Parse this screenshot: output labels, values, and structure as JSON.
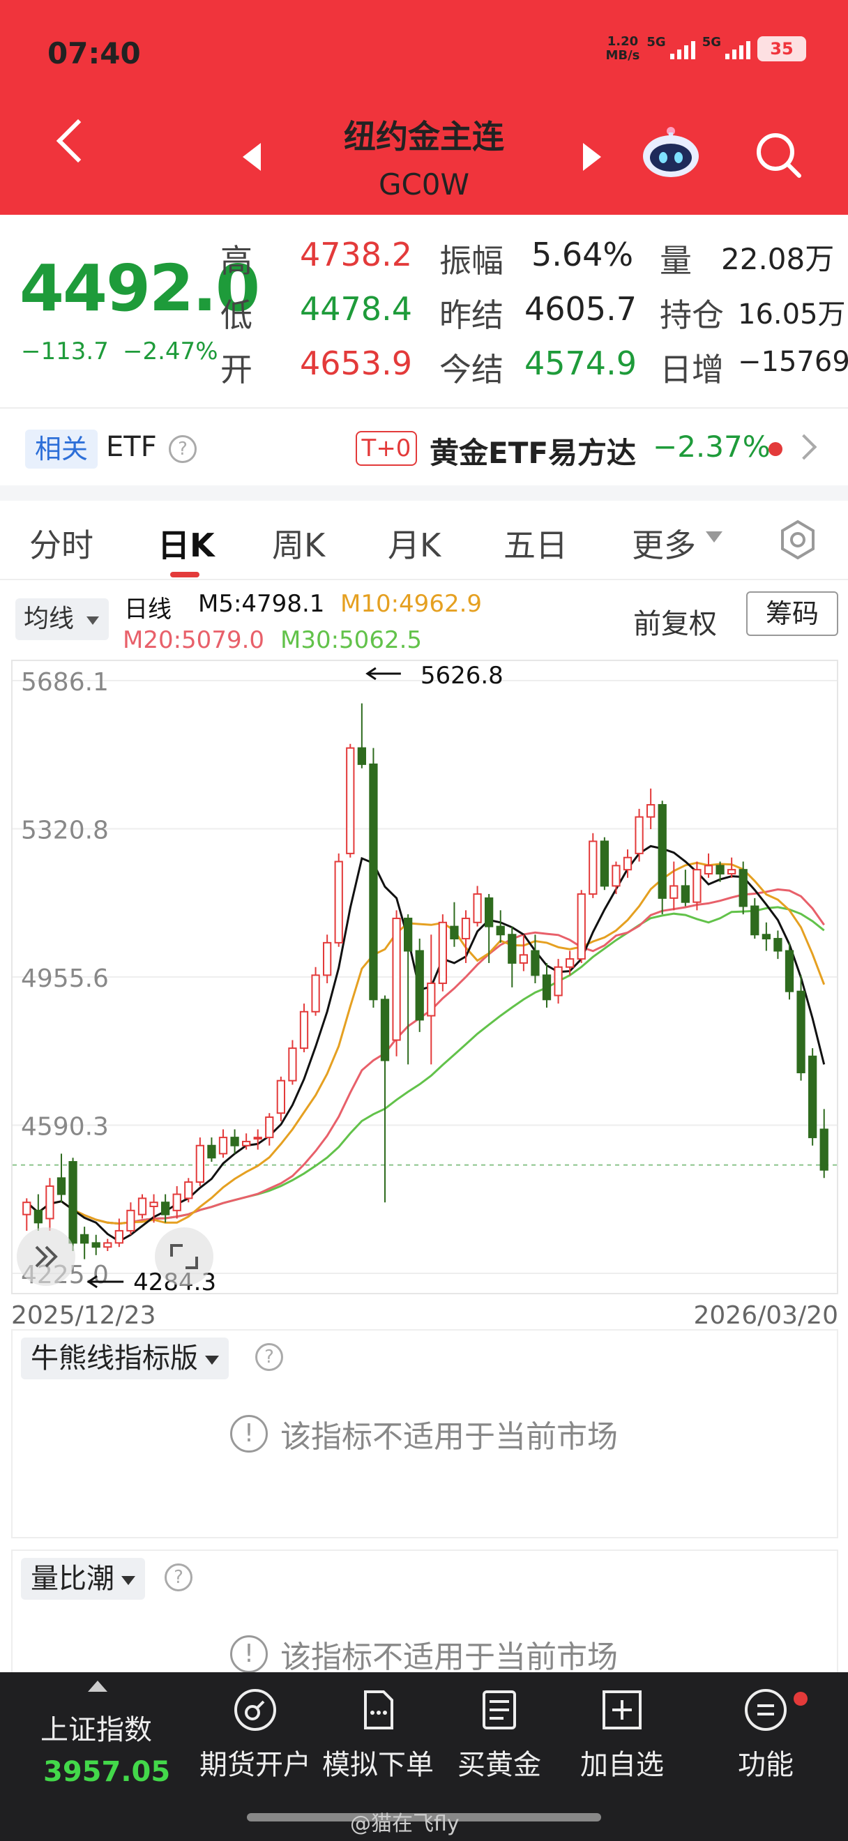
{
  "status_bar": {
    "time": "07:40",
    "net_speed_value": "1.20",
    "net_speed_unit": "MB/s",
    "signal1": "5G",
    "signal2": "5G",
    "battery": "35"
  },
  "header": {
    "title": "纽约金主连",
    "code": "GC0W",
    "bg_color": "#f0343c"
  },
  "quote": {
    "last": "4492.0",
    "change": "−113.7",
    "change_pct": "−2.47%",
    "high_label": "高",
    "high": "4738.2",
    "low_label": "低",
    "low": "4478.4",
    "open_label": "开",
    "open": "4653.9",
    "amp_label": "振幅",
    "amp": "5.64%",
    "prev_settle_label": "昨结",
    "prev_settle": "4605.7",
    "settle_label": "今结",
    "settle": "4574.9",
    "vol_label": "量",
    "vol": "22.08万",
    "oi_label": "持仓",
    "oi": "16.05万",
    "oi_chg_label": "日增",
    "oi_chg": "−15769"
  },
  "etf": {
    "tag": "相关",
    "word": "ETF",
    "t0": "T+0",
    "name": "黄金ETF易方达",
    "pct": "−2.37%"
  },
  "tabs": [
    {
      "label": "分时"
    },
    {
      "label": "日K"
    },
    {
      "label": "周K"
    },
    {
      "label": "月K"
    },
    {
      "label": "五日"
    },
    {
      "label": "更多"
    }
  ],
  "ma": {
    "select": "均线",
    "period": "日线",
    "m5": "M5:4798.1",
    "m10": "M10:4962.9",
    "m20": "M20:5079.0",
    "m30": "M30:5062.5",
    "adj": "前复权",
    "chips": "筹码",
    "colors": {
      "m5": "#111111",
      "m10": "#e5a021",
      "m20": "#e8606a",
      "m30": "#62c24a",
      "up": "#e33a3a",
      "down": "#2e6b1e"
    }
  },
  "chart_data": {
    "type": "candlestick",
    "y_ticks": [
      "5686.1",
      "5320.8",
      "4955.6",
      "4590.3",
      "4225.0"
    ],
    "ylim": [
      4225.0,
      5686.1
    ],
    "max_label": "5626.8",
    "min_label": "4284.3",
    "date_start": "2025/12/23",
    "date_end": "2026/03/20",
    "ref_line": 4492.0,
    "candles": [
      [
        4370,
        4400,
        4330,
        4410
      ],
      [
        4380,
        4350,
        4330,
        4420
      ],
      [
        4360,
        4440,
        4330,
        4460
      ],
      [
        4460,
        4420,
        4400,
        4520
      ],
      [
        4500,
        4300,
        4280,
        4510
      ],
      [
        4320,
        4300,
        4260,
        4340
      ],
      [
        4300,
        4290,
        4270,
        4320
      ],
      [
        4290,
        4300,
        4280,
        4310
      ],
      [
        4300,
        4330,
        4290,
        4360
      ],
      [
        4330,
        4380,
        4320,
        4400
      ],
      [
        4370,
        4410,
        4360,
        4420
      ],
      [
        4390,
        4400,
        4350,
        4420
      ],
      [
        4400,
        4370,
        4350,
        4420
      ],
      [
        4380,
        4420,
        4360,
        4440
      ],
      [
        4410,
        4450,
        4400,
        4460
      ],
      [
        4450,
        4540,
        4440,
        4560
      ],
      [
        4540,
        4510,
        4500,
        4560
      ],
      [
        4520,
        4560,
        4510,
        4580
      ],
      [
        4560,
        4540,
        4520,
        4580
      ],
      [
        4540,
        4550,
        4530,
        4570
      ],
      [
        4560,
        4560,
        4530,
        4580
      ],
      [
        4560,
        4610,
        4540,
        4620
      ],
      [
        4620,
        4700,
        4600,
        4710
      ],
      [
        4700,
        4780,
        4690,
        4800
      ],
      [
        4780,
        4870,
        4770,
        4890
      ],
      [
        4870,
        4960,
        4860,
        4980
      ],
      [
        4960,
        5040,
        4940,
        5060
      ],
      [
        5040,
        5240,
        5030,
        5260
      ],
      [
        5260,
        5520,
        5250,
        5530
      ],
      [
        5520,
        5480,
        5470,
        5630
      ],
      [
        5480,
        4900,
        4880,
        5520
      ],
      [
        4900,
        4750,
        4400,
        4910
      ],
      [
        4800,
        5100,
        4760,
        5120
      ],
      [
        5100,
        5020,
        4740,
        5110
      ],
      [
        5020,
        4850,
        4820,
        5050
      ],
      [
        4860,
        4940,
        4740,
        5060
      ],
      [
        4940,
        5090,
        4920,
        5110
      ],
      [
        5080,
        5050,
        5030,
        5140
      ],
      [
        5050,
        5100,
        4990,
        5120
      ],
      [
        5090,
        5160,
        5080,
        5180
      ],
      [
        5150,
        5080,
        4990,
        5160
      ],
      [
        5080,
        5060,
        5040,
        5120
      ],
      [
        5060,
        4990,
        4930,
        5080
      ],
      [
        4990,
        5010,
        4970,
        5060
      ],
      [
        5020,
        4960,
        4940,
        5060
      ],
      [
        4960,
        4900,
        4880,
        4990
      ],
      [
        4910,
        4980,
        4890,
        5000
      ],
      [
        4980,
        5000,
        4960,
        5020
      ],
      [
        5000,
        5160,
        4990,
        5170
      ],
      [
        5160,
        5290,
        5150,
        5310
      ],
      [
        5290,
        5180,
        5170,
        5300
      ],
      [
        5180,
        5230,
        5160,
        5240
      ],
      [
        5220,
        5250,
        5200,
        5270
      ],
      [
        5260,
        5350,
        5240,
        5370
      ],
      [
        5350,
        5380,
        5320,
        5420
      ],
      [
        5380,
        5150,
        5110,
        5390
      ],
      [
        5150,
        5180,
        5120,
        5240
      ],
      [
        5180,
        5140,
        5130,
        5220
      ],
      [
        5140,
        5220,
        5120,
        5240
      ],
      [
        5210,
        5230,
        5200,
        5260
      ],
      [
        5230,
        5210,
        5190,
        5240
      ],
      [
        5210,
        5220,
        5200,
        5250
      ],
      [
        5220,
        5130,
        5110,
        5240
      ],
      [
        5130,
        5060,
        5050,
        5150
      ],
      [
        5060,
        5050,
        5020,
        5090
      ],
      [
        5050,
        5020,
        5000,
        5070
      ],
      [
        5020,
        4920,
        4900,
        5040
      ],
      [
        4920,
        4720,
        4700,
        4960
      ],
      [
        4760,
        4560,
        4540,
        4780
      ],
      [
        4580,
        4480,
        4460,
        4630
      ]
    ]
  },
  "panel1": {
    "select": "牛熊线指标版",
    "notice": "该指标不适用于当前市场"
  },
  "panel2": {
    "select": "量比潮",
    "notice": "该指标不适用于当前市场"
  },
  "bottom_nav": {
    "index_name": "上证指数",
    "index_value": "3957.05",
    "items": [
      {
        "label": "期货开户",
        "icon": "account-icon"
      },
      {
        "label": "模拟下单",
        "icon": "sim-order-icon"
      },
      {
        "label": "买黄金",
        "icon": "buy-gold-icon"
      },
      {
        "label": "加自选",
        "icon": "add-watch-icon"
      },
      {
        "label": "功能",
        "icon": "menu-icon"
      }
    ],
    "watermark": "@猫在飞fly"
  }
}
